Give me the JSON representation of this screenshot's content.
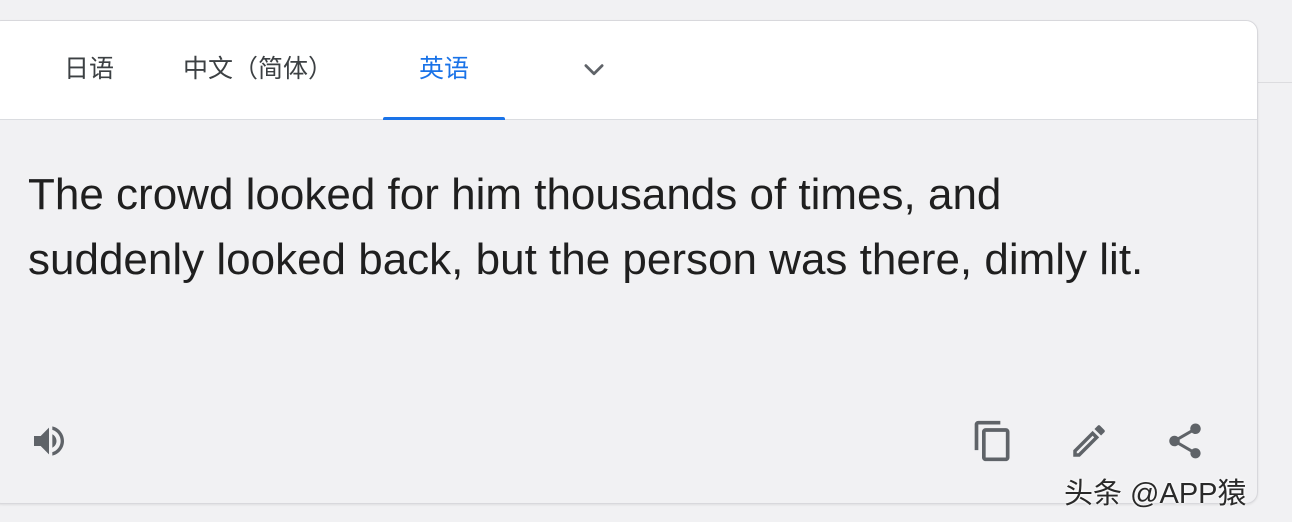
{
  "tabs": [
    {
      "label": "日语",
      "active": false
    },
    {
      "label": "中文（简体）",
      "active": false
    },
    {
      "label": "英语",
      "active": true
    }
  ],
  "more_languages_icon": "chevron-down-icon",
  "translation": {
    "text": "The crowd looked for him thousands of times, and suddenly looked back, but the person was there, dimly lit."
  },
  "actions": {
    "listen_icon": "speaker-icon",
    "copy_icon": "copy-icon",
    "edit_icon": "pencil-icon",
    "share_icon": "share-icon"
  },
  "watermark": {
    "text": "头条 @APP猿"
  },
  "colors": {
    "accent": "#1a73e8",
    "icon": "#5f6368",
    "text": "#1f1f1f",
    "panel": "#f1f1f3"
  }
}
